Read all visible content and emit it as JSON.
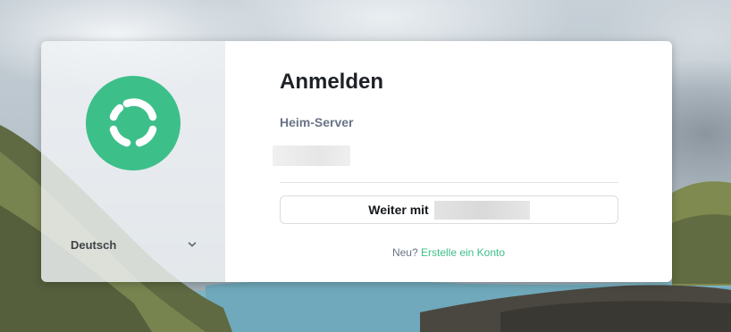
{
  "login": {
    "title": "Anmelden",
    "homeserver_label": "Heim-Server",
    "homeserver_value": "",
    "continue_label": "Weiter mit",
    "continue_server": "",
    "signup_prefix": "Neu?",
    "signup_link": "Erstelle ein Konto"
  },
  "sidebar": {
    "language": "Deutsch",
    "language_icon": "chevron-down-icon",
    "logo_icon": "element-logo-icon"
  },
  "colors": {
    "accent": "#3dbf8a",
    "heading": "#1e2226",
    "muted": "#6a7486"
  }
}
